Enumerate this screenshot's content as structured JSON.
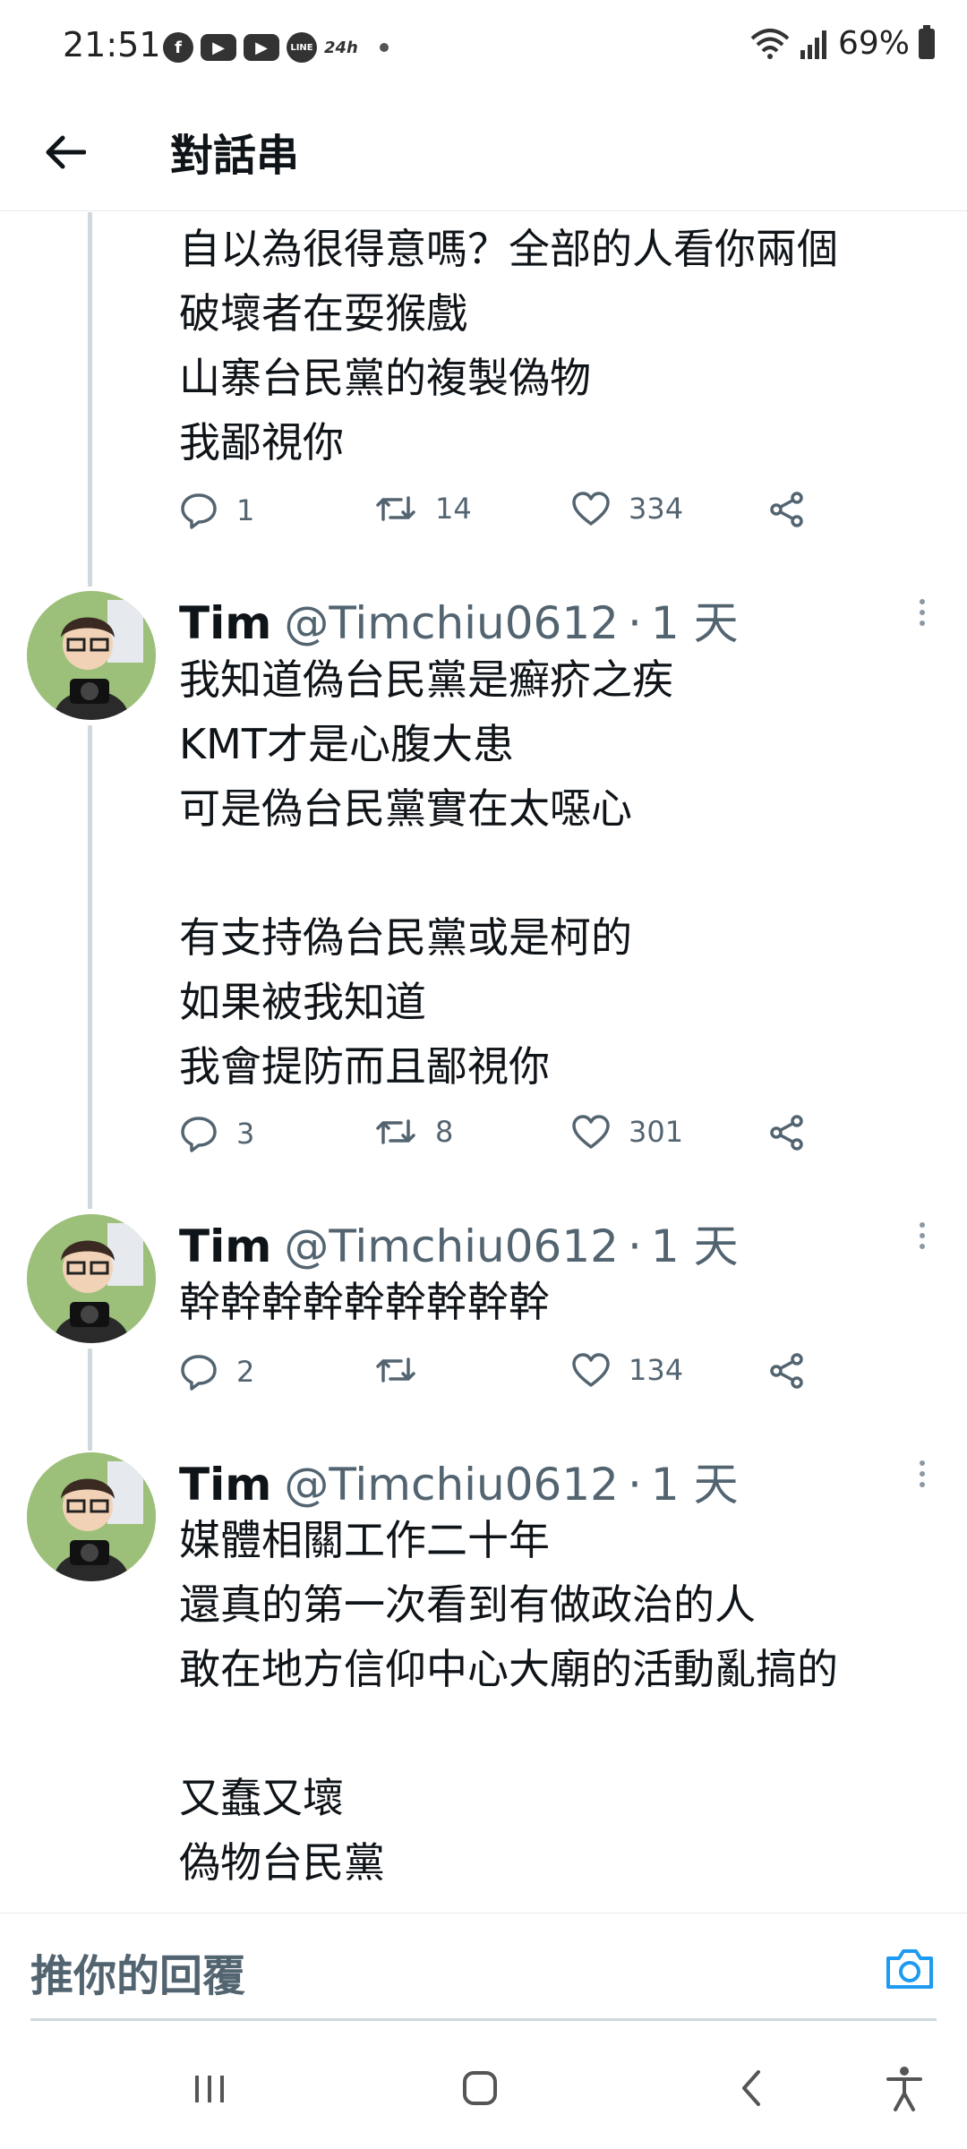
{
  "status_bar": {
    "time": "21:51",
    "notif_icons": [
      "facebook-icon",
      "youtube-icon",
      "youtube-icon",
      "line-icon",
      "24h-icon"
    ],
    "line_label": "LINE",
    "h24_label": "24h",
    "battery": "69%"
  },
  "header": {
    "title": "對話串"
  },
  "tweets": [
    {
      "text": "自以為很得意嗎？全部的人看你兩個\n破壞者在耍猴戲\n山寨台民黨的複製偽物\n我鄙視你",
      "replies": "1",
      "retweets": "14",
      "likes": "334"
    },
    {
      "name": "Tim",
      "handle": "@Timchiu0612",
      "dot": "·",
      "time": "1 天",
      "text": "我知道偽台民黨是癬疥之疾\nKMT才是心腹大患\n可是偽台民黨實在太噁心\n\n有支持偽台民黨或是柯的\n如果被我知道\n我會提防而且鄙視你",
      "replies": "3",
      "retweets": "8",
      "likes": "301"
    },
    {
      "name": "Tim",
      "handle": "@Timchiu0612",
      "dot": "·",
      "time": "1 天",
      "text": "幹幹幹幹幹幹幹幹幹",
      "replies": "2",
      "retweets": "",
      "likes": "134"
    },
    {
      "name": "Tim",
      "handle": "@Timchiu0612",
      "dot": "·",
      "time": "1 天",
      "text": "媒體相關工作二十年\n還真的第一次看到有做政治的人\n敢在地方信仰中心大廟的活動亂搞的\n\n又蠢又壞\n偽物台民黨"
    }
  ],
  "reply_box": {
    "placeholder": "推你的回覆"
  },
  "colors": {
    "text": "#0f1419",
    "secondary": "#536471",
    "thread_line": "#cfd9de",
    "accent": "#1d9bf0"
  }
}
